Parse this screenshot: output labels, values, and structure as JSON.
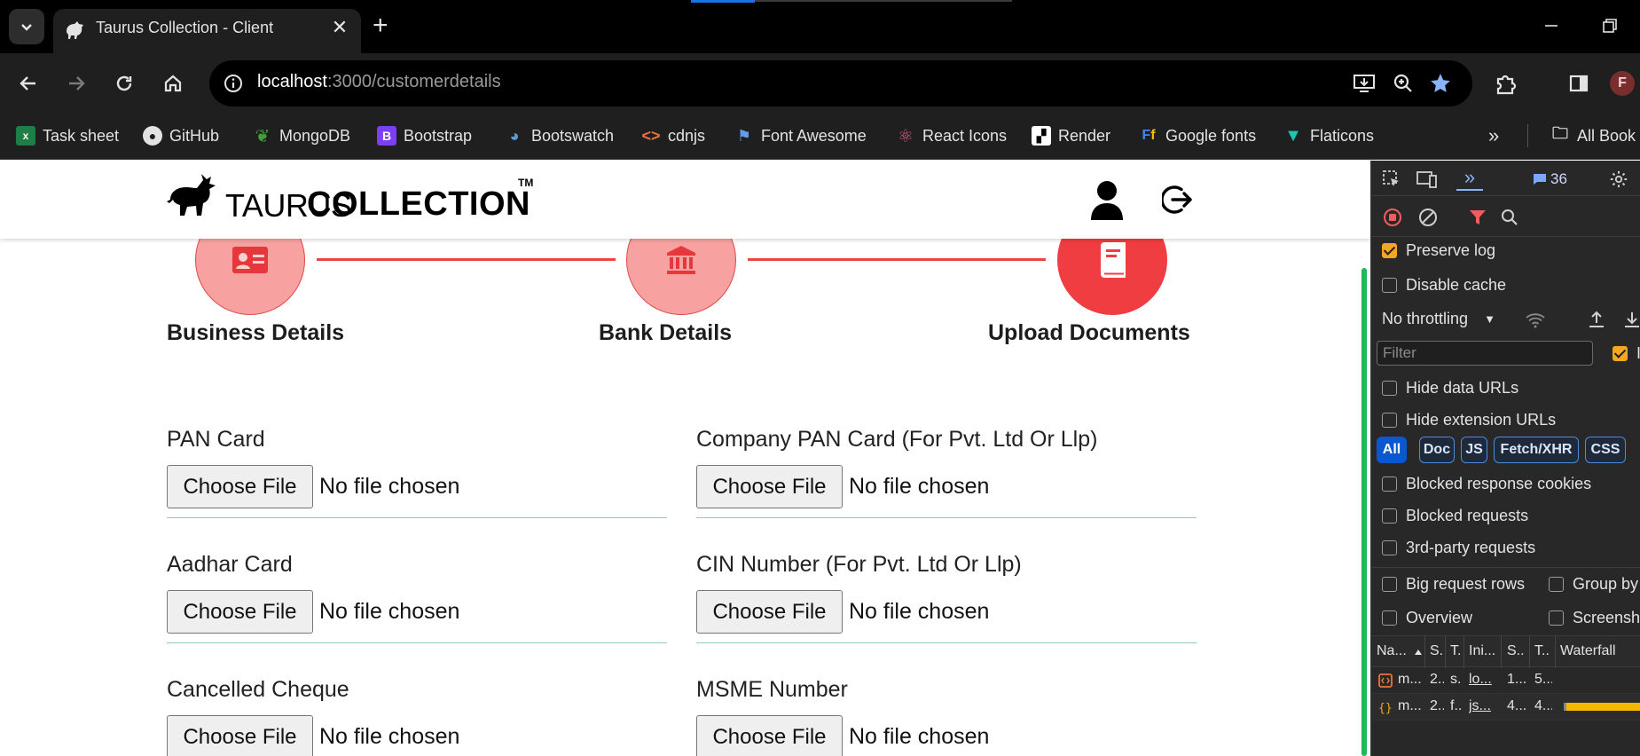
{
  "browser": {
    "tab_title": "Taurus Collection - Client",
    "new_tab_symbol": "+",
    "url_host": "localhost",
    "url_path": ":3000/customerdetails",
    "profile_initial": "F",
    "bookmarks": [
      {
        "label": "Task sheet",
        "icon": "sheets-icon"
      },
      {
        "label": "GitHub",
        "icon": "github-icon"
      },
      {
        "label": "MongoDB",
        "icon": "mongodb-icon"
      },
      {
        "label": "Bootstrap",
        "icon": "bootstrap-icon"
      },
      {
        "label": "Bootswatch",
        "icon": "bootswatch-icon"
      },
      {
        "label": "cdnjs",
        "icon": "code-icon"
      },
      {
        "label": "Font Awesome",
        "icon": "flag-icon"
      },
      {
        "label": "React Icons",
        "icon": "react-icon"
      },
      {
        "label": "Render",
        "icon": "render-icon"
      },
      {
        "label": "Google fonts",
        "icon": "google-fonts-icon"
      },
      {
        "label": "Flaticons",
        "icon": "flaticon-icon"
      }
    ],
    "overflow_chevron": "»",
    "all_bookmarks": "All Book"
  },
  "site": {
    "logo_text_light": "TAURUS",
    "logo_text_bold": "COLLECTION",
    "logo_tm": "TM"
  },
  "stepper": {
    "steps": [
      {
        "label": "Business Details",
        "icon": "id-card-icon",
        "state": "done"
      },
      {
        "label": "Bank Details",
        "icon": "bank-icon",
        "state": "done"
      },
      {
        "label": "Upload Documents",
        "icon": "book-icon",
        "state": "active"
      }
    ],
    "colors": {
      "done": "#f7a1a1",
      "active": "#ef3d41",
      "line": "#e84545"
    }
  },
  "form": {
    "button_label": "Choose File",
    "status_text": "No file chosen",
    "fields": [
      {
        "label": "PAN Card"
      },
      {
        "label": "Company PAN Card (For Pvt. Ltd Or Llp)"
      },
      {
        "label": "Aadhar Card"
      },
      {
        "label": "CIN Number (For Pvt. Ltd Or Llp)"
      },
      {
        "label": "Cancelled Cheque"
      },
      {
        "label": "MSME Number"
      }
    ]
  },
  "devtools": {
    "more_tabs": "»",
    "issues_count": "36",
    "preserve_log": "Preserve log",
    "disable_cache": "Disable cache",
    "throttling": "No throttling",
    "filter_placeholder": "Filter",
    "invert_label": "I",
    "hide_data_urls": "Hide data URLs",
    "hide_extension_urls": "Hide extension URLs",
    "chips": [
      "All",
      "Doc",
      "JS",
      "Fetch/XHR",
      "CSS"
    ],
    "blocked_cookies": "Blocked response cookies",
    "blocked_requests": "Blocked requests",
    "third_party": "3rd-party requests",
    "big_rows": "Big request rows",
    "group_by": "Group by",
    "overview": "Overview",
    "screenshots": "Screensho",
    "columns": [
      "Na...",
      "S.",
      "T.",
      "Ini...",
      "S..",
      "T..",
      "Waterfall"
    ],
    "rows": [
      [
        "m...",
        "2..",
        "s..",
        "lo...",
        "1...",
        "5..."
      ],
      [
        "m...",
        "2..",
        "f...",
        "js...",
        "4...",
        "4..."
      ]
    ],
    "accent": "#f5a623"
  }
}
